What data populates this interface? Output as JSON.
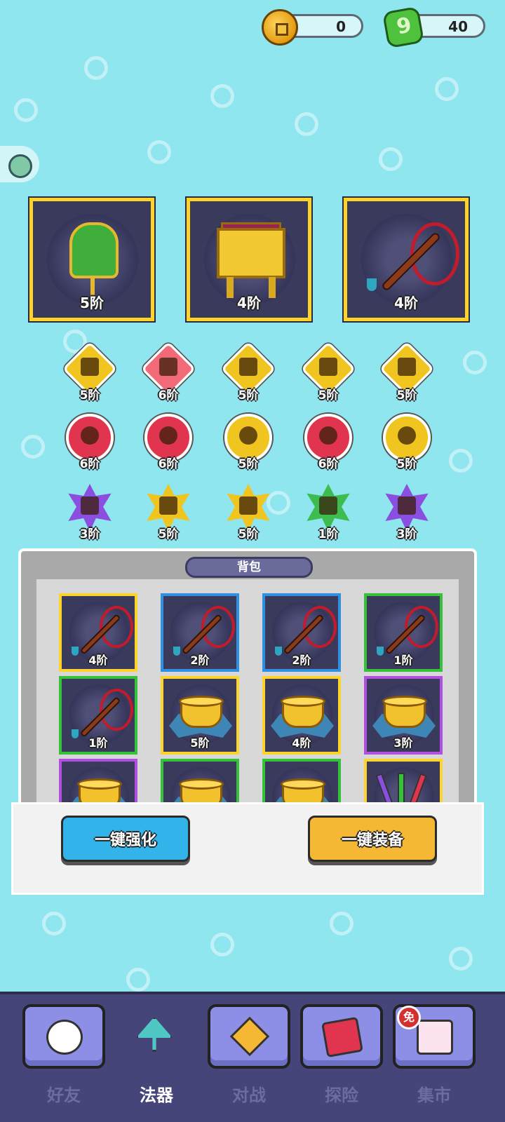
{
  "currency": {
    "coins": "0",
    "gems": "40"
  },
  "equipped": [
    {
      "item": "fan",
      "grade": "5阶"
    },
    {
      "item": "cauldron",
      "grade": "4阶"
    },
    {
      "item": "whip",
      "grade": "4阶"
    }
  ],
  "gems_row1": [
    {
      "shape": "diamond",
      "color": "#f1c51f",
      "icon": "sword-icon",
      "grade": "5阶"
    },
    {
      "shape": "diamond",
      "color": "#f26a78",
      "icon": "sword-icon",
      "grade": "6阶"
    },
    {
      "shape": "diamond",
      "color": "#f1c51f",
      "icon": "shield-icon",
      "grade": "5阶"
    },
    {
      "shape": "diamond",
      "color": "#f1c51f",
      "icon": "sword-icon",
      "grade": "5阶"
    },
    {
      "shape": "diamond",
      "color": "#f1c51f",
      "icon": "shield-icon",
      "grade": "5阶"
    }
  ],
  "gems_row2": [
    {
      "shape": "circle",
      "color": "#e0344f",
      "icon": "clover-icon",
      "grade": "6阶"
    },
    {
      "shape": "circle",
      "color": "#e0344f",
      "icon": "clover-icon",
      "grade": "6阶"
    },
    {
      "shape": "circle",
      "color": "#f1c51f",
      "icon": "clover-icon",
      "grade": "5阶"
    },
    {
      "shape": "circle",
      "color": "#e0344f",
      "icon": "heart-icon",
      "grade": "6阶"
    },
    {
      "shape": "circle",
      "color": "#f1c51f",
      "icon": "clover-icon",
      "grade": "5阶"
    }
  ],
  "gems_row3": [
    {
      "shape": "star",
      "color": "#8a4ee0",
      "icon": "wing-icon",
      "grade": "3阶"
    },
    {
      "shape": "star",
      "color": "#f1c51f",
      "icon": "wing-icon",
      "grade": "5阶"
    },
    {
      "shape": "star",
      "color": "#f1c51f",
      "icon": "wing-icon",
      "grade": "5阶"
    },
    {
      "shape": "star",
      "color": "#3dbd4f",
      "icon": "wing-icon",
      "grade": "1阶"
    },
    {
      "shape": "star",
      "color": "#8a4ee0",
      "icon": "wing-icon",
      "grade": "3阶"
    }
  ],
  "backpack": {
    "title": "背包",
    "items": [
      {
        "item": "whip",
        "border": "#ffd42a",
        "grade": "4阶"
      },
      {
        "item": "whip",
        "border": "#2f8fe0",
        "grade": "2阶"
      },
      {
        "item": "whip",
        "border": "#2f8fe0",
        "grade": "2阶"
      },
      {
        "item": "whip",
        "border": "#35c23a",
        "grade": "1阶"
      },
      {
        "item": "whip",
        "border": "#35c23a",
        "grade": "1阶"
      },
      {
        "item": "bowl",
        "border": "#ffd42a",
        "grade": "5阶"
      },
      {
        "item": "bowl",
        "border": "#ffd42a",
        "grade": "4阶"
      },
      {
        "item": "bowl",
        "border": "#b04fe0",
        "grade": "3阶"
      },
      {
        "item": "bowl",
        "border": "#b04fe0",
        "grade": ""
      },
      {
        "item": "bowl",
        "border": "#35c23a",
        "grade": ""
      },
      {
        "item": "bowl",
        "border": "#35c23a",
        "grade": ""
      },
      {
        "item": "swords",
        "border": "#ffd42a",
        "grade": ""
      }
    ]
  },
  "actions": {
    "upgrade_all": "一键强化",
    "equip_all": "一键装备"
  },
  "nav": {
    "friends": "好友",
    "artifacts": "法器",
    "battle": "对战",
    "explore": "探险",
    "market": "集市",
    "free_badge": "免"
  }
}
